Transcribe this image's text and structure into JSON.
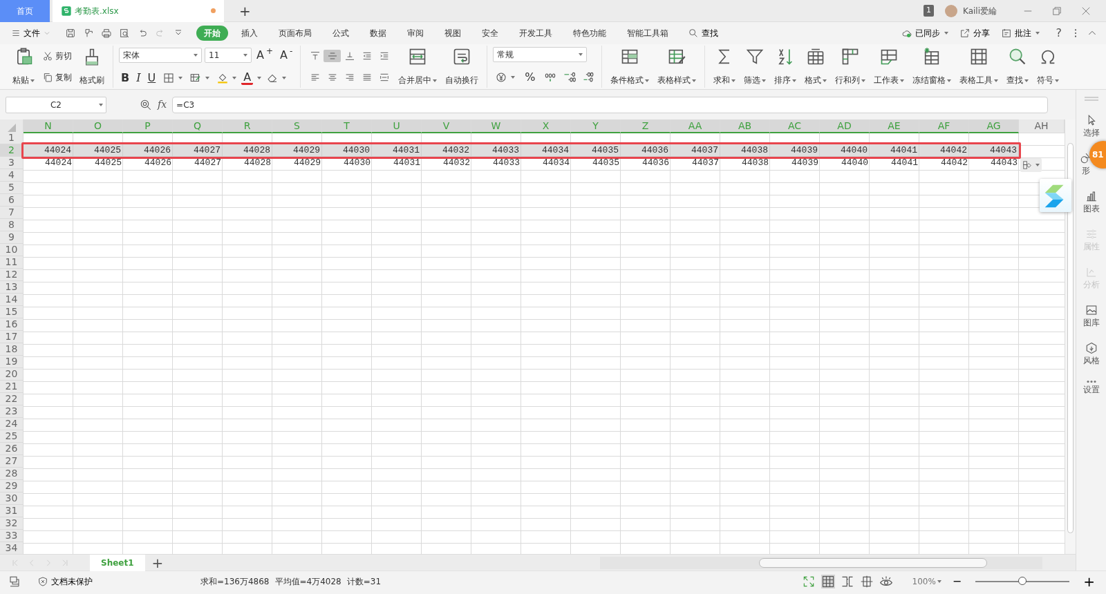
{
  "title_bar": {
    "tabs": [
      {
        "label": "首页",
        "kind": "home",
        "selected": false,
        "modified": false
      },
      {
        "label": "考勤表.xlsx",
        "kind": "file",
        "selected": true,
        "modified": true
      }
    ],
    "new_tab": "+",
    "window_count": "1",
    "user": "Kaili爱綸"
  },
  "menu_bar": {
    "file_menu": "文件",
    "ribbon_tabs": [
      {
        "label": "开始",
        "selected": true
      },
      {
        "label": "插入",
        "selected": false
      },
      {
        "label": "页面布局",
        "selected": false
      },
      {
        "label": "公式",
        "selected": false
      },
      {
        "label": "数据",
        "selected": false
      },
      {
        "label": "审阅",
        "selected": false
      },
      {
        "label": "视图",
        "selected": false
      },
      {
        "label": "安全",
        "selected": false
      },
      {
        "label": "开发工具",
        "selected": false
      },
      {
        "label": "特色功能",
        "selected": false
      },
      {
        "label": "智能工具箱",
        "selected": false
      }
    ],
    "search": "查找",
    "sync": "已同步",
    "share": "分享",
    "comment": "批注",
    "help": "?"
  },
  "ribbon": {
    "clipboard": [
      {
        "label": "粘贴",
        "dropdown": true
      },
      {
        "label": "剪切",
        "dropdown": false
      },
      {
        "label": "复制",
        "dropdown": false
      },
      {
        "label": "格式刷",
        "dropdown": false
      }
    ],
    "font": {
      "font_name": "宋体",
      "font_size": "11",
      "size_buttons": [
        "A$^{+}$",
        "A$^{-}$"
      ],
      "style_buttons": [
        "B",
        "I",
        "U"
      ],
      "font_color": "A"
    },
    "align_buttons": [
      {
        "pressed": false
      },
      {
        "pressed": true
      },
      {
        "pressed": false
      },
      {
        "pressed": false
      },
      {
        "pressed": false
      },
      {
        "pressed": false
      },
      {
        "pressed": false
      },
      {
        "pressed": false
      },
      {
        "pressed": false
      },
      {
        "pressed": false
      }
    ],
    "align_big": [
      {
        "label": "合并居中",
        "dropdown": true
      },
      {
        "label": "自动换行",
        "dropdown": false
      }
    ],
    "number": {
      "format": "常规",
      "percent": "%"
    },
    "tools": [
      {
        "label": "条件格式",
        "dropdown": true
      },
      {
        "label": "表格样式",
        "dropdown": true
      },
      {
        "label": "求和",
        "dropdown": true
      },
      {
        "label": "筛选",
        "dropdown": true
      },
      {
        "label": "排序",
        "dropdown": true
      },
      {
        "label": "格式",
        "dropdown": true
      },
      {
        "label": "行和列",
        "dropdown": true
      },
      {
        "label": "工作表",
        "dropdown": true
      },
      {
        "label": "冻结窗格",
        "dropdown": true
      },
      {
        "label": "表格工具",
        "dropdown": true
      },
      {
        "label": "查找",
        "dropdown": true
      },
      {
        "label": "符号",
        "dropdown": true
      }
    ]
  },
  "formula_bar": {
    "name_box": "C2",
    "fx": "fx",
    "formula": "=C3"
  },
  "sheet": {
    "columns": [
      {
        "label": "N",
        "selected": true
      },
      {
        "label": "O",
        "selected": true
      },
      {
        "label": "P",
        "selected": true
      },
      {
        "label": "Q",
        "selected": true
      },
      {
        "label": "R",
        "selected": true
      },
      {
        "label": "S",
        "selected": true
      },
      {
        "label": "T",
        "selected": true
      },
      {
        "label": "U",
        "selected": true
      },
      {
        "label": "V",
        "selected": true
      },
      {
        "label": "W",
        "selected": true
      },
      {
        "label": "X",
        "selected": true
      },
      {
        "label": "Y",
        "selected": true
      },
      {
        "label": "Z",
        "selected": true
      },
      {
        "label": "AA",
        "selected": true
      },
      {
        "label": "AB",
        "selected": true
      },
      {
        "label": "AC",
        "selected": true
      },
      {
        "label": "AD",
        "selected": true
      },
      {
        "label": "AE",
        "selected": true
      },
      {
        "label": "AF",
        "selected": true
      },
      {
        "label": "AG",
        "selected": true
      },
      {
        "label": "AH",
        "selected": false
      }
    ],
    "rows": [
      {
        "label": "1",
        "selected": false,
        "outlined": false,
        "cells": []
      },
      {
        "label": "2",
        "selected": true,
        "outlined": true,
        "cells": [
          "44024",
          "44025",
          "44026",
          "44027",
          "44028",
          "44029",
          "44030",
          "44031",
          "44032",
          "44033",
          "44034",
          "44035",
          "44036",
          "44037",
          "44038",
          "44039",
          "44040",
          "44041",
          "44042",
          "44043"
        ]
      },
      {
        "label": "3",
        "selected": false,
        "outlined": false,
        "cells": [
          "44024",
          "44025",
          "44026",
          "44027",
          "44028",
          "44029",
          "44030",
          "44031",
          "44032",
          "44033",
          "44034",
          "44035",
          "44036",
          "44037",
          "44038",
          "44039",
          "44040",
          "44041",
          "44042",
          "44043"
        ]
      },
      {
        "label": "4",
        "selected": false,
        "outlined": false,
        "cells": []
      },
      {
        "label": "5",
        "selected": false,
        "outlined": false,
        "cells": []
      },
      {
        "label": "6",
        "selected": false,
        "outlined": false,
        "cells": []
      },
      {
        "label": "7",
        "selected": false,
        "outlined": false,
        "cells": []
      },
      {
        "label": "8",
        "selected": false,
        "outlined": false,
        "cells": []
      },
      {
        "label": "9",
        "selected": false,
        "outlined": false,
        "cells": []
      },
      {
        "label": "10",
        "selected": false,
        "outlined": false,
        "cells": []
      },
      {
        "label": "11",
        "selected": false,
        "outlined": false,
        "cells": []
      },
      {
        "label": "12",
        "selected": false,
        "outlined": false,
        "cells": []
      },
      {
        "label": "13",
        "selected": false,
        "outlined": false,
        "cells": []
      },
      {
        "label": "14",
        "selected": false,
        "outlined": false,
        "cells": []
      },
      {
        "label": "15",
        "selected": false,
        "outlined": false,
        "cells": []
      },
      {
        "label": "16",
        "selected": false,
        "outlined": false,
        "cells": []
      },
      {
        "label": "17",
        "selected": false,
        "outlined": false,
        "cells": []
      },
      {
        "label": "18",
        "selected": false,
        "outlined": false,
        "cells": []
      },
      {
        "label": "19",
        "selected": false,
        "outlined": false,
        "cells": []
      },
      {
        "label": "20",
        "selected": false,
        "outlined": false,
        "cells": []
      },
      {
        "label": "21",
        "selected": false,
        "outlined": false,
        "cells": []
      },
      {
        "label": "22",
        "selected": false,
        "outlined": false,
        "cells": []
      },
      {
        "label": "23",
        "selected": false,
        "outlined": false,
        "cells": []
      },
      {
        "label": "24",
        "selected": false,
        "outlined": false,
        "cells": []
      },
      {
        "label": "25",
        "selected": false,
        "outlined": false,
        "cells": []
      },
      {
        "label": "26",
        "selected": false,
        "outlined": false,
        "cells": []
      },
      {
        "label": "27",
        "selected": false,
        "outlined": false,
        "cells": []
      },
      {
        "label": "28",
        "selected": false,
        "outlined": false,
        "cells": []
      },
      {
        "label": "29",
        "selected": false,
        "outlined": false,
        "cells": []
      },
      {
        "label": "30",
        "selected": false,
        "outlined": false,
        "cells": []
      },
      {
        "label": "31",
        "selected": false,
        "outlined": false,
        "cells": []
      },
      {
        "label": "32",
        "selected": false,
        "outlined": false,
        "cells": []
      },
      {
        "label": "33",
        "selected": false,
        "outlined": false,
        "cells": []
      },
      {
        "label": "34",
        "selected": false,
        "outlined": false,
        "cells": []
      }
    ]
  },
  "side_panel": {
    "items": [
      {
        "label": "选择",
        "disabled": false
      },
      {
        "label": "形",
        "disabled": false
      },
      {
        "label": "图表",
        "disabled": false
      },
      {
        "label": "属性",
        "disabled": true
      },
      {
        "label": "分析",
        "disabled": true
      },
      {
        "label": "图库",
        "disabled": false
      },
      {
        "label": "风格",
        "disabled": false
      },
      {
        "label": "设置",
        "disabled": false
      }
    ],
    "badge": "81"
  },
  "sheet_tabs": {
    "tabs": [
      {
        "label": "Sheet1",
        "selected": true
      }
    ],
    "add": "+"
  },
  "status_bar": {
    "protection": "文档未保护",
    "sum": "求和=136万4868",
    "average": "平均值=4万4028",
    "count": "计数=31",
    "zoom": "100%",
    "zoom_level": {
      "level": 0.5
    },
    "minus": "−",
    "plus": "+"
  }
}
